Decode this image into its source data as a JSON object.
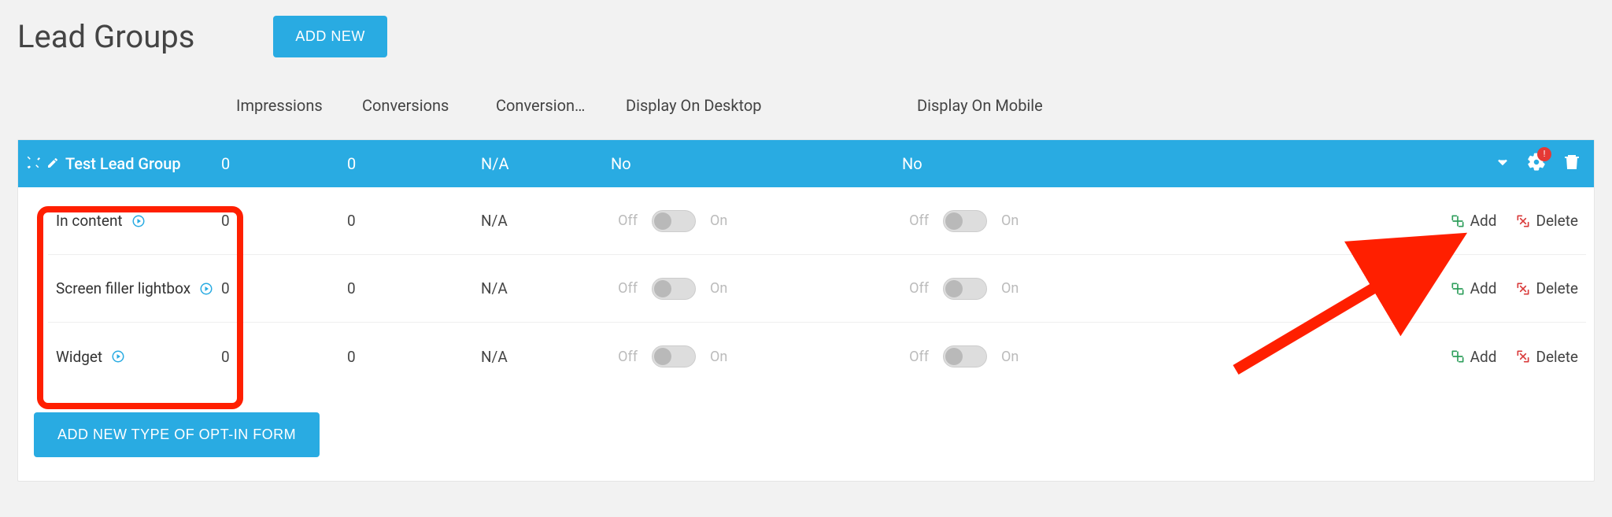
{
  "page": {
    "title": "Lead Groups",
    "add_new_label": "ADD NEW",
    "add_form_label": "ADD NEW TYPE OF OPT-IN FORM"
  },
  "columns": {
    "impressions": "Impressions",
    "conversions": "Conversions",
    "conversion_rate": "Conversion…",
    "display_desktop": "Display On Desktop",
    "display_mobile": "Display On Mobile"
  },
  "group": {
    "name": "Test Lead Group",
    "impressions": "0",
    "conversions": "0",
    "conversion_rate": "N/A",
    "display_desktop": "No",
    "display_mobile": "No",
    "alert": "!"
  },
  "toggle_labels": {
    "off": "Off",
    "on": "On"
  },
  "action_labels": {
    "add": "Add",
    "delete": "Delete"
  },
  "rows": [
    {
      "name": "In content",
      "impressions": "0",
      "conversions": "0",
      "conversion_rate": "N/A"
    },
    {
      "name": "Screen filler lightbox",
      "impressions": "0",
      "conversions": "0",
      "conversion_rate": "N/A"
    },
    {
      "name": "Widget",
      "impressions": "0",
      "conversions": "0",
      "conversion_rate": "N/A"
    }
  ]
}
